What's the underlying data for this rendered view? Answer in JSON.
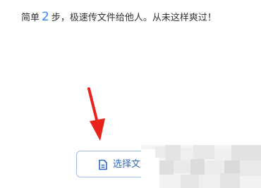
{
  "intro": {
    "prefix": "简单",
    "step_count": "2",
    "suffix": "步，极速传文件给他人。从未这样爽过！"
  },
  "upload": {
    "select_button_label": "选择文",
    "icon": "file-icon",
    "accent_color": "#3a86ff",
    "arrow_color": "#e8231b"
  }
}
